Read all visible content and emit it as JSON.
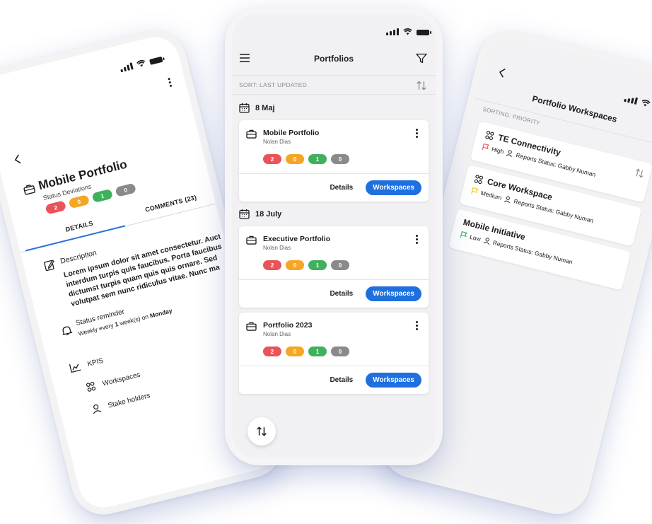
{
  "left": {
    "title": "Mobile Portfolio",
    "status_label": "Status Deviations",
    "pills": [
      "2",
      "0",
      "1",
      "0"
    ],
    "tabs": {
      "details": "DETAILS",
      "comments": "COMMENTS (23)"
    },
    "description_heading": "Description",
    "description_lines": [
      "Lorem ipsum dolor sit amet consectetur. Auct",
      "interdum turpis quis faucibus. Porta faucibus",
      "dictumst turpis quam quis quis ornare. Sed",
      "volutpat sem nunc ridiculus vitae. Nunc ma"
    ],
    "reminder_heading": "Status reminder",
    "reminder_text_pre": "Weekly every",
    "reminder_num": "1",
    "reminder_text_mid": "week(s) on",
    "reminder_day": "Monday",
    "kpis": "KPIS",
    "workspaces": "Workspaces",
    "stakeholders": "Stake holders"
  },
  "center": {
    "title": "Portfolios",
    "sort_label": "SORT: LAST UPDATED",
    "groups": [
      {
        "date": "8 Maj",
        "cards": [
          {
            "name": "Mobile Portfolio",
            "owner": "Nolan Dias",
            "pills": [
              "2",
              "0",
              "1",
              "0"
            ],
            "details": "Details",
            "workspaces": "Workspaces"
          }
        ]
      },
      {
        "date": "18 July",
        "cards": [
          {
            "name": "Executive Portfolio",
            "owner": "Nolan Dias",
            "pills": [
              "2",
              "0",
              "1",
              "0"
            ],
            "details": "Details",
            "workspaces": "Workspaces"
          },
          {
            "name": "Portfolio 2023",
            "owner": "Nolan Dias",
            "pills": [
              "2",
              "0",
              "1",
              "0"
            ],
            "details": "Details",
            "workspaces": "Workspaces"
          }
        ]
      }
    ]
  },
  "right": {
    "title": "Portfolio Workspaces",
    "sort_label": "SORTING: PRIORITY",
    "workspaces": [
      {
        "name": "TE Connectivity",
        "priority": "High",
        "priority_color": "#e8545a",
        "reports": "Reports Status: Gabby Numan"
      },
      {
        "name": "Core Workspace",
        "priority": "Medium",
        "priority_color": "#f5c518",
        "reports": "Reports Status: Gabby Numan"
      },
      {
        "name": "Mobile Initiative",
        "priority": "Low",
        "priority_color": "#3fb15d",
        "reports": "Reports Status: Gabby Numan"
      }
    ]
  },
  "colors": {
    "accent": "#1f6fde",
    "red": "#e8545a",
    "orange": "#f5a623",
    "green": "#3fb15d",
    "gray": "#8a8a8a"
  }
}
